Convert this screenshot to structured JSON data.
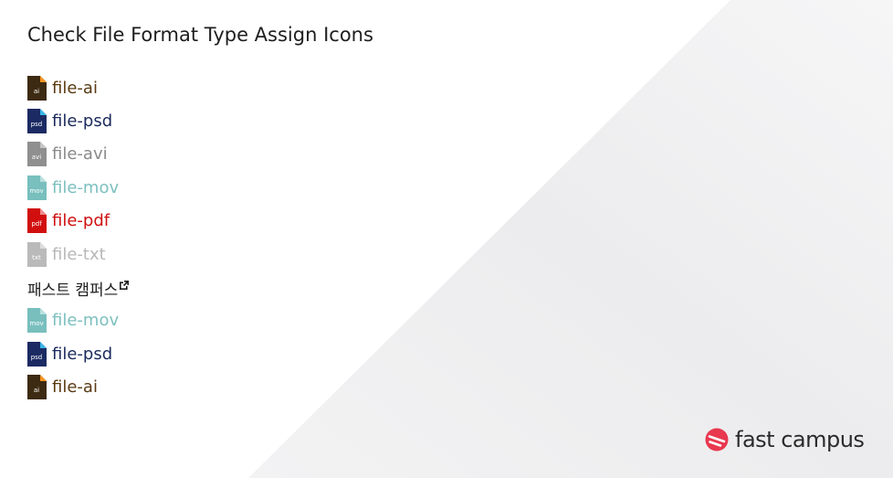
{
  "page": {
    "title": "Check File Format Type Assign Icons"
  },
  "files": [
    {
      "name": "file-ai",
      "ext": "ai",
      "icon": "ai-file-icon",
      "color": "#5a3a12",
      "iconColor": "#3d2a12",
      "foldColor": "#f7941d"
    },
    {
      "name": "file-psd",
      "ext": "psd",
      "icon": "psd-file-icon",
      "color": "#1b2a5c",
      "iconColor": "#1c2a63",
      "foldColor": "#38b6e8"
    },
    {
      "name": "file-avi",
      "ext": "avi",
      "icon": "avi-file-icon",
      "color": "#8a8a8a",
      "iconColor": "#8f8f8f",
      "foldColor": "#c5c5c5"
    },
    {
      "name": "file-mov",
      "ext": "mov",
      "icon": "mov-file-icon",
      "color": "#7cc0bf",
      "iconColor": "#78bfbe",
      "foldColor": "#b9e0df"
    },
    {
      "name": "file-pdf",
      "ext": "pdf",
      "icon": "pdf-file-icon",
      "color": "#d01010",
      "iconColor": "#d10f0f",
      "foldColor": "#f08a8a"
    },
    {
      "name": "file-txt",
      "ext": "txt",
      "icon": "txt-file-icon",
      "color": "#b8b8b8",
      "iconColor": "#bababa",
      "foldColor": "#dedede"
    }
  ],
  "korean_link": {
    "label": "패스트 캠퍼스",
    "icon": "external-link-icon"
  },
  "extra_files": [
    {
      "name": "file-mov",
      "ext": "mov",
      "icon": "mov-file-icon",
      "color": "#7cc0bf",
      "iconColor": "#78bfbe",
      "foldColor": "#b9e0df"
    },
    {
      "name": "file-psd",
      "ext": "psd",
      "icon": "psd-file-icon",
      "color": "#1b2a5c",
      "iconColor": "#1c2a63",
      "foldColor": "#38b6e8"
    },
    {
      "name": "file-ai",
      "ext": "ai",
      "icon": "ai-file-icon",
      "color": "#5a3a12",
      "iconColor": "#3d2a12",
      "foldColor": "#f7941d"
    }
  ],
  "brand": {
    "name": "fast campus",
    "icon": "fastcampus-logo-icon",
    "accent": "#e8384f"
  }
}
